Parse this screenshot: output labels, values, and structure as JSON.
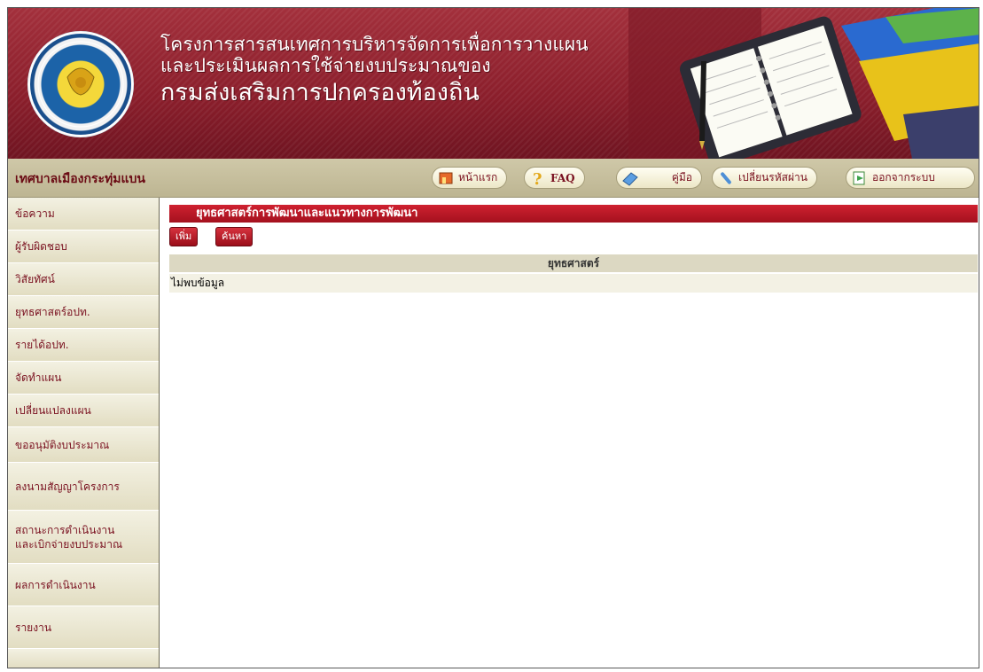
{
  "banner": {
    "title_line1": "โครงการสารสนเทศการบริหารจัดการเพื่อการวางแผน",
    "title_line2": "และประเมินผลการใช้จ่ายงบประมาณของ",
    "title_line3": "กรมส่งเสริมการปกครองท้องถิ่น"
  },
  "toolbar": {
    "org_name": "เทศบาลเมืองกระทุ่มแบน",
    "buttons": {
      "home": "หน้าแรก",
      "faq": "FAQ",
      "manual": "คู่มือ",
      "change_password": "เปลี่ยนรหัสผ่าน",
      "logout": "ออกจากระบบ"
    }
  },
  "sidebar": {
    "items": [
      {
        "label": "ข้อความ"
      },
      {
        "label": "ผู้รับผิดชอบ"
      },
      {
        "label": "วิสัยทัศน์"
      },
      {
        "label": "ยุทธศาสตร์อปท."
      },
      {
        "label": "รายได้อปท."
      },
      {
        "label": "จัดทำแผน"
      },
      {
        "label": "เปลี่ยนแปลงแผน"
      },
      {
        "label": "ขออนุมัติงบประมาณ"
      },
      {
        "label": "ลงนามสัญญาโครงการ"
      },
      {
        "label": "สถานะการดำเนินงาน",
        "label2": "และเบิกจ่ายงบประมาณ"
      },
      {
        "label": "ผลการดำเนินงาน"
      },
      {
        "label": "รายงาน"
      }
    ]
  },
  "main": {
    "section_title": "ยุทธศาสตร์การพัฒนาและแนวทางการพัฒนา",
    "add_button": "เพิ่ม",
    "search_button": "ค้นหา",
    "table_header": "ยุทธศาสตร์",
    "empty_message": "ไม่พบข้อมูล"
  },
  "colors": {
    "banner": "#8a1e2b",
    "accent_red": "#b5141f",
    "toolbar": "#c6bf9d",
    "sidebar_item": "#e8e4cc"
  }
}
